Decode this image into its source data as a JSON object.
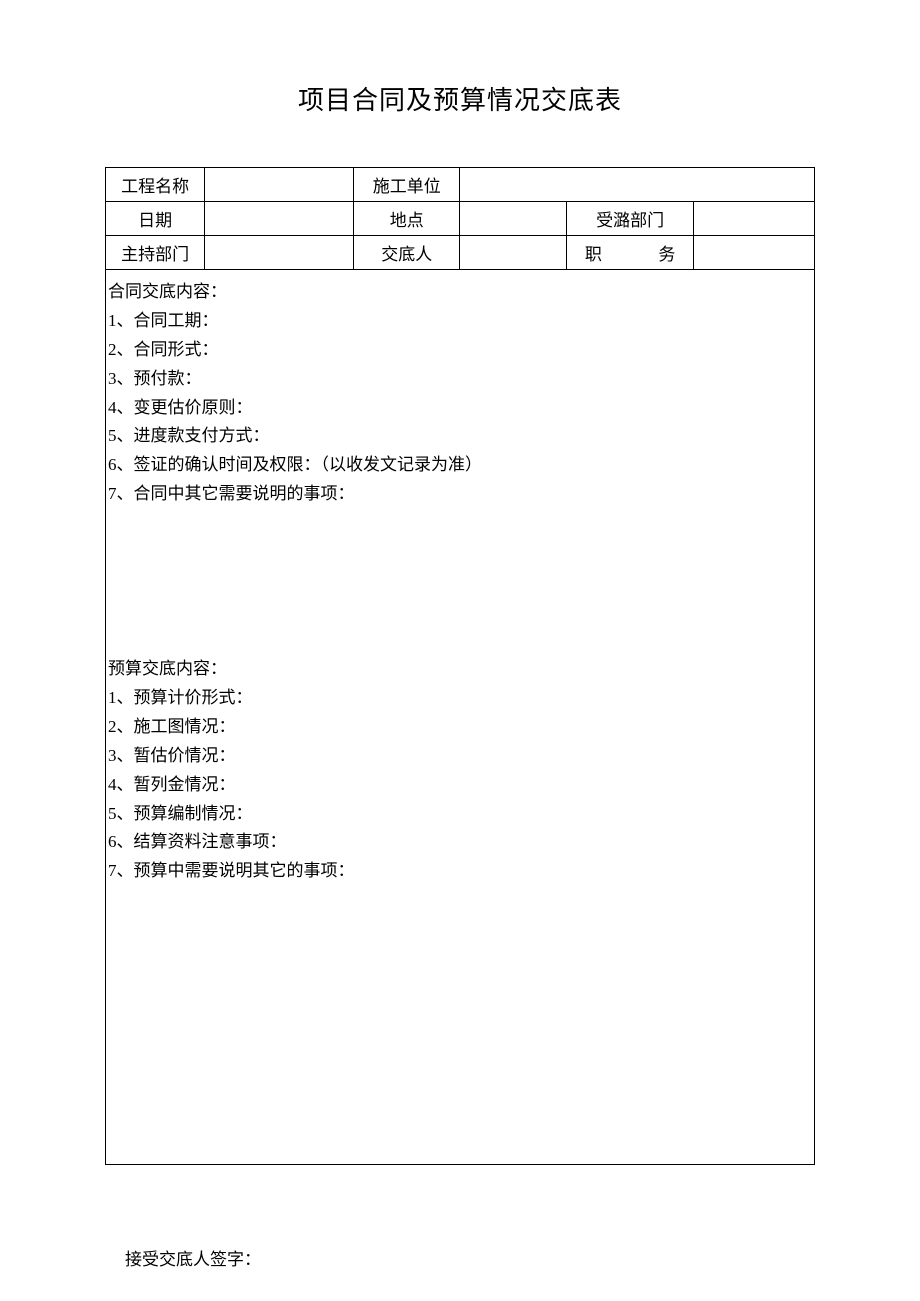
{
  "title": "项目合同及预算情况交底表",
  "header": {
    "row1": {
      "project_name_label": "工程名称",
      "project_name_value": "",
      "construction_unit_label": "施工单位",
      "construction_unit_value": ""
    },
    "row2": {
      "date_label": "日期",
      "date_value": "",
      "location_label": "地点",
      "location_value": "",
      "recv_dept_label": "受潞部门",
      "recv_dept_value": ""
    },
    "row3": {
      "host_dept_label": "主持部门",
      "host_dept_value": "",
      "discloser_label": "交底人",
      "discloser_value": "",
      "position_label": "职务",
      "position_value": ""
    }
  },
  "section1": {
    "heading": "合同交底内容：",
    "items": [
      "1、合同工期：",
      "2、合同形式：",
      "3、预付款：",
      "4、变更估价原则：",
      "5、进度款支付方式：",
      "6、签证的确认时间及权限：（以收发文记录为准）",
      "7、合同中其它需要说明的事项："
    ]
  },
  "section2": {
    "heading": "预算交底内容：",
    "items": [
      "1、预算计价形式：",
      "2、施工图情况：",
      "3、暂估价情况：",
      "4、暂列金情况：",
      "5、预算编制情况：",
      "6、结算资料注意事项：",
      "7、预算中需要说明其它的事项："
    ]
  },
  "signature_label": "接受交底人签字："
}
